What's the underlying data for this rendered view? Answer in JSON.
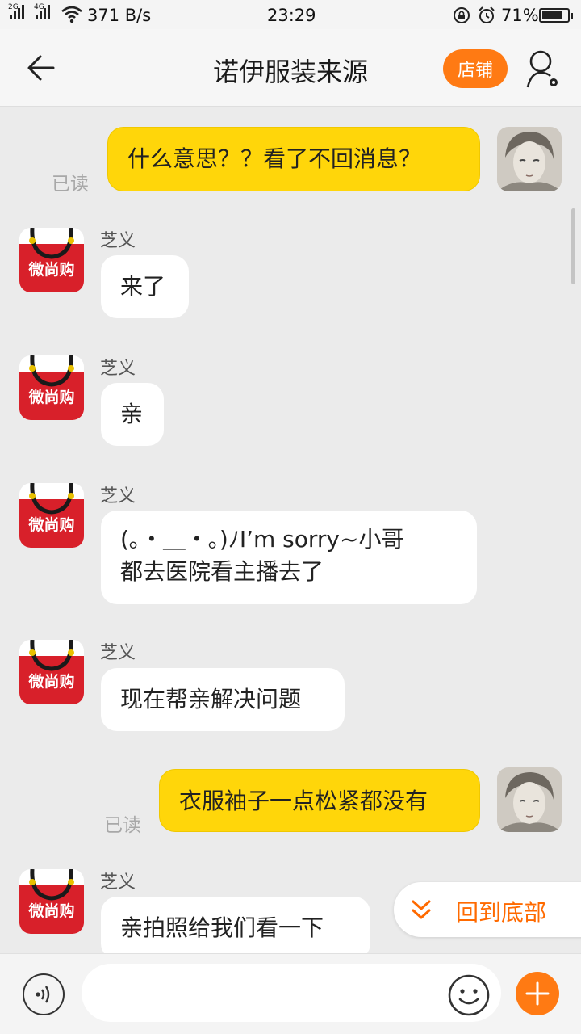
{
  "status_bar": {
    "sig1_label": "2G",
    "sig2_label": "4G",
    "net_speed": "371 B/s",
    "time": "23:29",
    "battery": "71%"
  },
  "header": {
    "title": "诺伊服装来源",
    "shop_label": "店铺"
  },
  "messages": [
    {
      "from": "me",
      "text": "什么意思？？看了不回消息？",
      "status": "已读"
    },
    {
      "from": "shop",
      "name": "芝义",
      "text": "来了",
      "avatar_text": "微尚购"
    },
    {
      "from": "shop",
      "name": "芝义",
      "text": "亲",
      "avatar_text": "微尚购"
    },
    {
      "from": "shop",
      "name": "芝义",
      "line1": "(｡・＿・｡)ﾉI’m sorry~小哥",
      "line2": "都去医院看主播去了",
      "avatar_text": "微尚购"
    },
    {
      "from": "shop",
      "name": "芝义",
      "text": "现在帮亲解决问题",
      "avatar_text": "微尚购"
    },
    {
      "from": "me",
      "text": "衣服袖子一点松紧都没有",
      "status": "已读"
    },
    {
      "from": "shop",
      "name": "芝义",
      "text": "亲拍照给我们看一下",
      "avatar_text": "微尚购"
    }
  ],
  "scroll_to_bottom": "回到底部",
  "input": {
    "placeholder": ""
  },
  "colors": {
    "accent": "#ff7a13",
    "my_bubble": "#ffd60a",
    "their_bubble": "#ffffff",
    "background": "#ebebeb",
    "avatar_red": "#d8202a"
  }
}
